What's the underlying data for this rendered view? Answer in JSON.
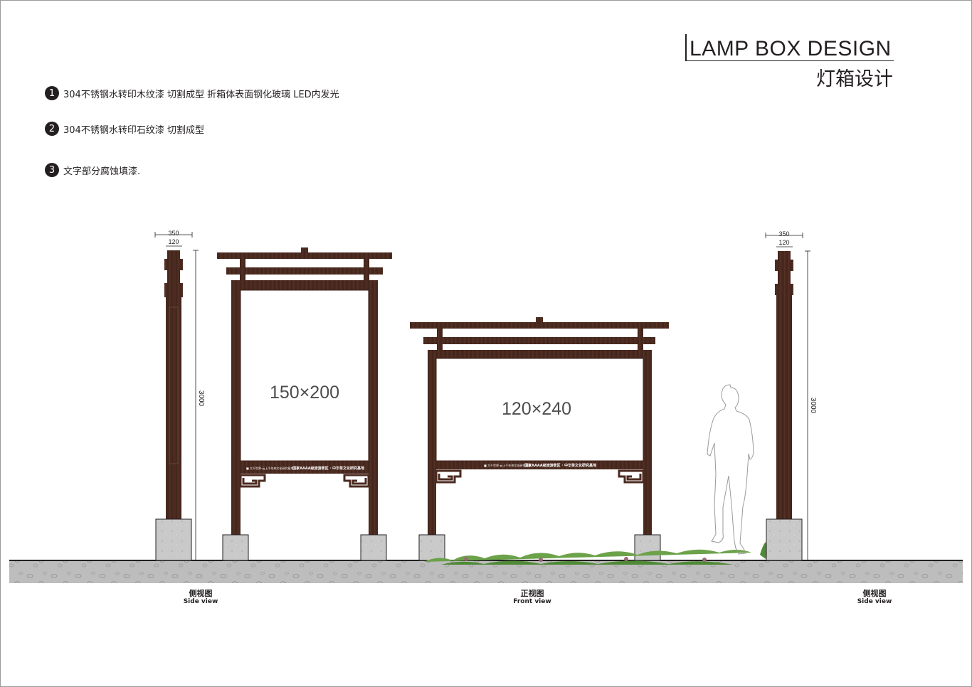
{
  "title": {
    "en": "LAMP BOX DESIGN",
    "cn": "灯箱设计"
  },
  "notes": [
    {
      "num": "1",
      "text": "304不锈钢水转印木纹漆 切割成型 折箱体表面钢化玻璃 LED内发光"
    },
    {
      "num": "2",
      "text": "304不锈钢水转印石纹漆 切割成型"
    },
    {
      "num": "3",
      "text": "文字部分腐蚀填漆."
    }
  ],
  "left_side": {
    "dim_top": "350",
    "dim_inner": "120",
    "height": "3000"
  },
  "right_side": {
    "dim_top": "350",
    "dim_inner": "120",
    "height": "3000"
  },
  "board_tall": {
    "size": "150×200",
    "strip_left": "■ 大千世界·云上千年茶文化研究基地",
    "strip_right": "国家AAAA级旅游景区 · 中华茶文化研究基地"
  },
  "board_wide": {
    "size": "120×240",
    "strip_left": "■ 大千世界·云上千年茶文化研究基地",
    "strip_right": "国家AAAA级旅游景区 · 中华茶文化研究基地"
  },
  "labels": {
    "left": {
      "cn": "侧视图",
      "en": "Side view"
    },
    "center": {
      "cn": "正视图",
      "en": "Front view"
    },
    "right": {
      "cn": "侧视图",
      "en": "Side view"
    }
  },
  "colors": {
    "wood": "#4b2a20",
    "wood_dark": "#3a1f17",
    "stone": "#c9c9c9",
    "ground": "#bdbdbd",
    "ink": "#231f20",
    "leaf": "#6ca24a"
  }
}
